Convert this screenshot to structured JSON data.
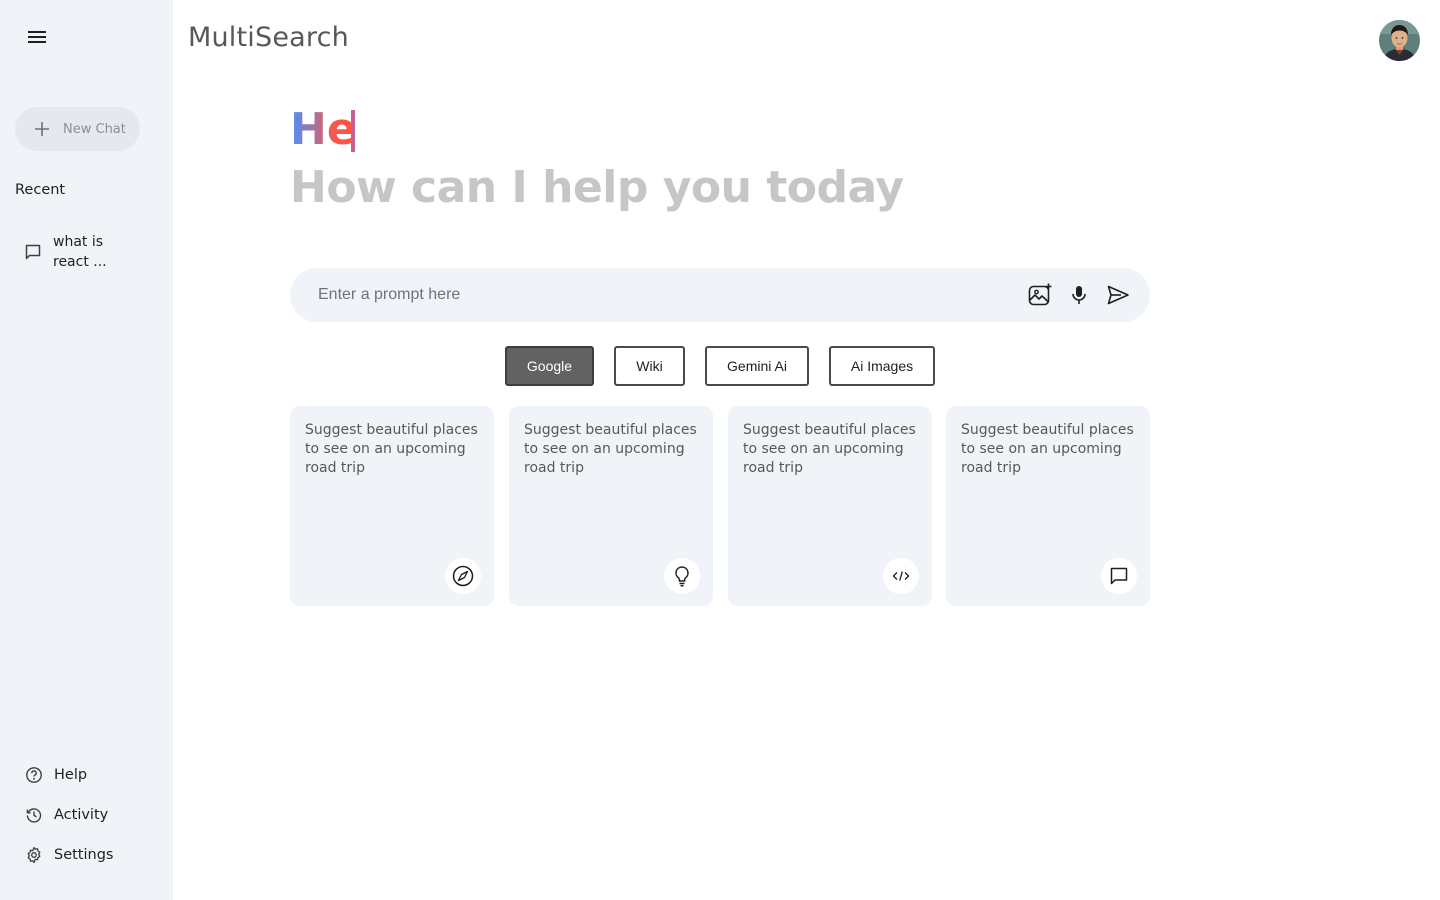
{
  "app": {
    "title": "MultiSearch"
  },
  "sidebar": {
    "new_chat_label": "New Chat",
    "recent_title": "Recent",
    "recent_items": [
      {
        "label": "what is react ..."
      }
    ],
    "bottom_items": [
      {
        "label": "Help",
        "icon": "help-icon"
      },
      {
        "label": "Activity",
        "icon": "history-icon"
      },
      {
        "label": "Settings",
        "icon": "gear-icon"
      }
    ]
  },
  "greeting": {
    "typed": "He",
    "subtitle": "How can I help you today"
  },
  "search": {
    "placeholder": "Enter a prompt here",
    "value": ""
  },
  "sources": [
    {
      "label": "Google",
      "active": true
    },
    {
      "label": "Wiki",
      "active": false
    },
    {
      "label": "Gemini Ai",
      "active": false
    },
    {
      "label": "Ai Images",
      "active": false
    }
  ],
  "cards": [
    {
      "text": "Suggest beautiful places to see on an upcoming road trip",
      "icon": "compass-icon"
    },
    {
      "text": "Suggest beautiful places to see on an upcoming road trip",
      "icon": "bulb-icon"
    },
    {
      "text": "Suggest beautiful places to see on an upcoming road trip",
      "icon": "code-icon"
    },
    {
      "text": "Suggest beautiful places to see on an upcoming road trip",
      "icon": "message-icon"
    }
  ],
  "colors": {
    "sidebar_bg": "#f0f4f9",
    "gradient_start": "#4b90ff",
    "gradient_end": "#ff5546",
    "active_source": "#626262"
  }
}
